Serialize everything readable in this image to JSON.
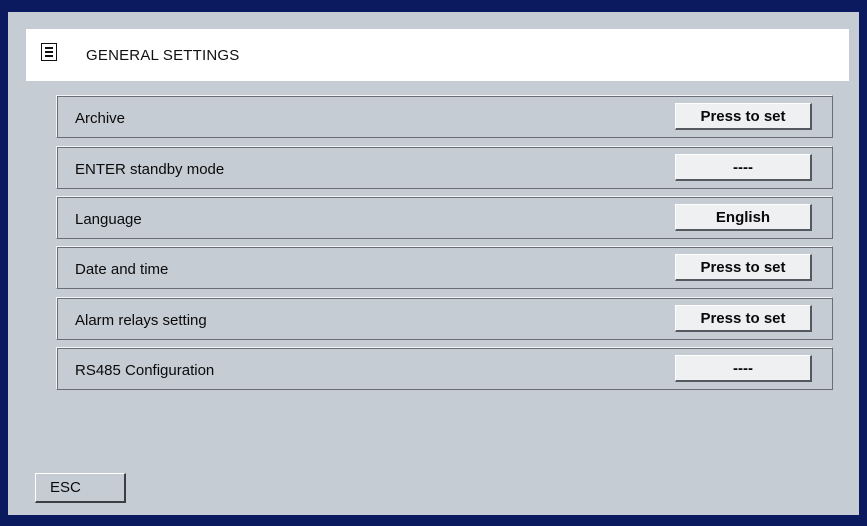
{
  "header": {
    "title": "GENERAL SETTINGS",
    "icon": "list-menu-icon"
  },
  "rows": [
    {
      "label": "Archive",
      "button": "Press to set"
    },
    {
      "label": "ENTER standby mode",
      "button": "----"
    },
    {
      "label": "Language",
      "button": "English"
    },
    {
      "label": "Date and time",
      "button": "Press to set"
    },
    {
      "label": "Alarm relays setting",
      "button": "Press to set"
    },
    {
      "label": "RS485 Configuration",
      "button": "----"
    }
  ],
  "footer": {
    "esc_label": "ESC"
  },
  "colors": {
    "frame": "#0b1a5e",
    "panel": "#c6ccd4",
    "header_bg": "#ffffff",
    "button_bg": "#eef0f2"
  }
}
